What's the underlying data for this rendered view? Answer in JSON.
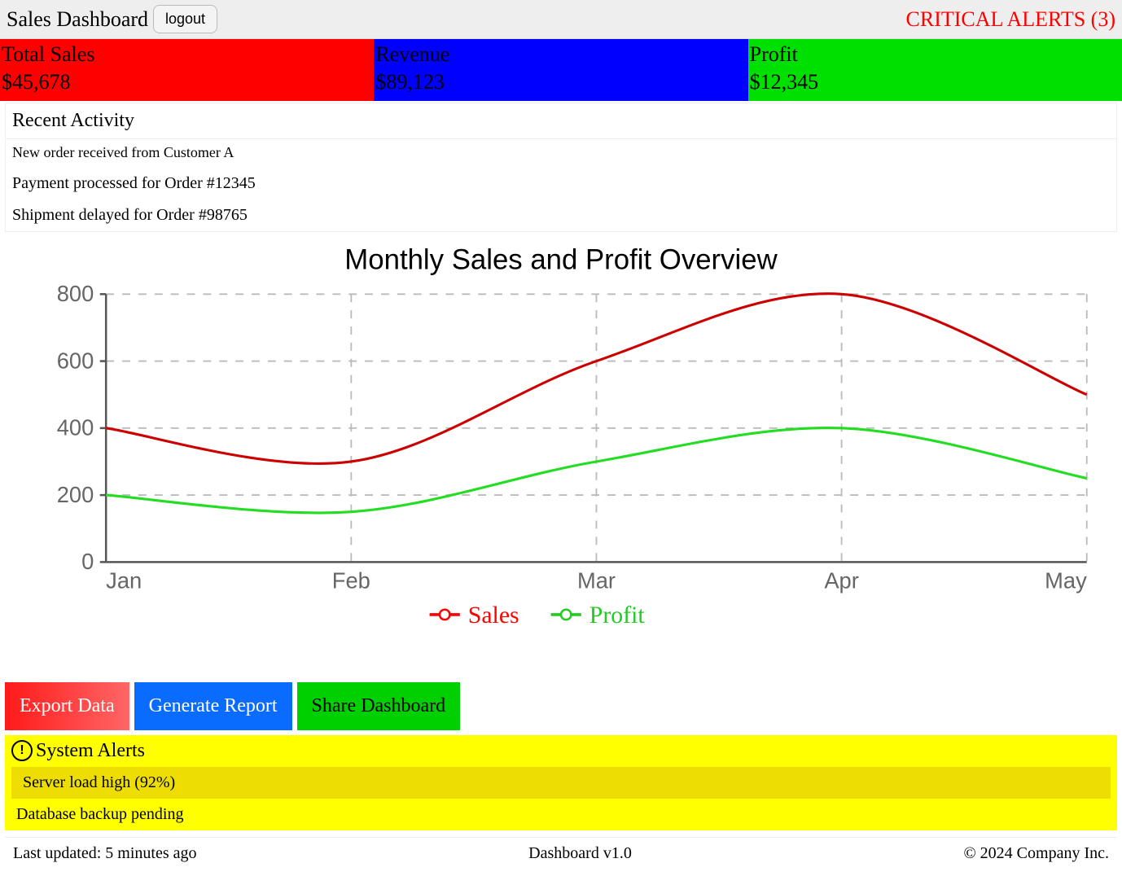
{
  "header": {
    "title": "Sales Dashboard",
    "logout_label": "logout",
    "critical_text": "CRITICAL ALERTS (3)"
  },
  "stats": [
    {
      "label": "Total Sales",
      "value": "$45,678",
      "color": "red"
    },
    {
      "label": "Revenue",
      "value": "$89,123",
      "color": "blue"
    },
    {
      "label": "Profit",
      "value": "$12,345",
      "color": "green"
    }
  ],
  "recent": {
    "title": "Recent Activity",
    "items": [
      "New order received from Customer A",
      "Payment processed for Order #12345",
      "Shipment delayed for Order #98765"
    ]
  },
  "chart_data": {
    "type": "line",
    "title": "Monthly Sales and Profit Overview",
    "categories": [
      "Jan",
      "Feb",
      "Mar",
      "Apr",
      "May"
    ],
    "series": [
      {
        "name": "Sales",
        "values": [
          400,
          300,
          600,
          800,
          500
        ],
        "color": "#cc0000"
      },
      {
        "name": "Profit",
        "values": [
          200,
          150,
          300,
          400,
          250
        ],
        "color": "#22dd22"
      }
    ],
    "ylim": [
      0,
      800
    ],
    "yticks": [
      0,
      200,
      400,
      600,
      800
    ],
    "xlabel": "",
    "ylabel": "",
    "legend_position": "bottom"
  },
  "actions": {
    "export": "Export Data",
    "report": "Generate Report",
    "share": "Share Dashboard"
  },
  "system_alerts": {
    "title": "System Alerts",
    "items": [
      "Server load high (92%)",
      "Database backup pending"
    ]
  },
  "footer": {
    "updated": "Last updated: 5 minutes ago",
    "version": "Dashboard v1.0",
    "copyright": "© 2024 Company Inc."
  }
}
